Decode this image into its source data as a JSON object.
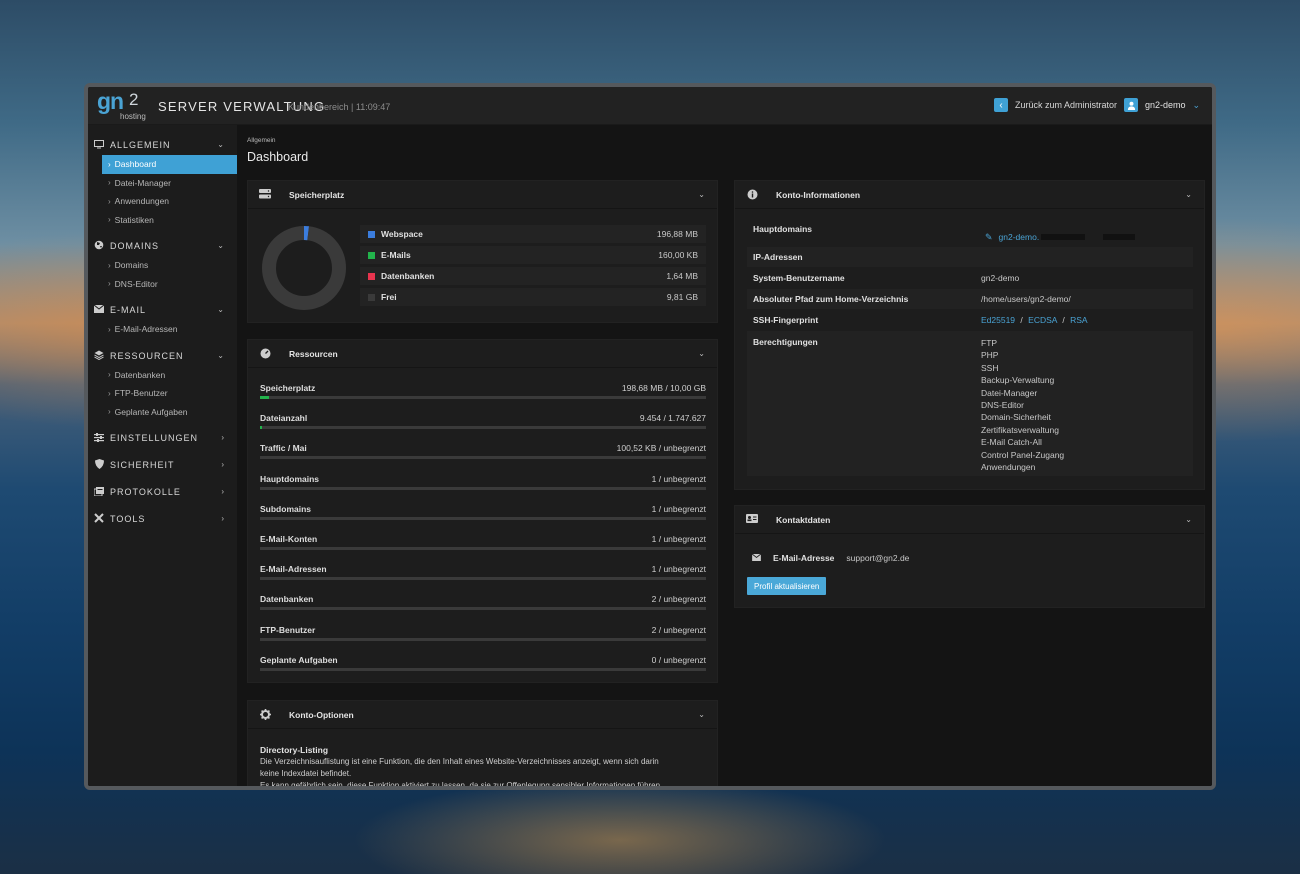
{
  "header": {
    "logo_main": "gn",
    "logo_sup": "2",
    "logo_sub": "hosting",
    "app_title": "SERVER VERWALTUNG",
    "app_subtitle": "Kundenbereich | 11:09:47",
    "admin_link": "Zurück zum Administrator",
    "user": "gn2-demo"
  },
  "sidebar": {
    "sections": [
      {
        "label": "ALLGEMEIN",
        "icon": "monitor-icon",
        "items": [
          "Dashboard",
          "Datei-Manager",
          "Anwendungen",
          "Statistiken"
        ]
      },
      {
        "label": "DOMAINS",
        "icon": "globe-icon",
        "items": [
          "Domains",
          "DNS-Editor"
        ]
      },
      {
        "label": "E-MAIL",
        "icon": "envelope-icon",
        "items": [
          "E-Mail-Adressen"
        ]
      },
      {
        "label": "RESSOURCEN",
        "icon": "layers-icon",
        "items": [
          "Datenbanken",
          "FTP-Benutzer",
          "Geplante Aufgaben"
        ]
      },
      {
        "label": "EINSTELLUNGEN",
        "icon": "sliders-icon",
        "items": []
      },
      {
        "label": "SICHERHEIT",
        "icon": "shield-icon",
        "items": []
      },
      {
        "label": "PROTOKOLLE",
        "icon": "logs-icon",
        "items": []
      },
      {
        "label": "TOOLS",
        "icon": "tools-icon",
        "items": []
      }
    ],
    "active_item": "Dashboard"
  },
  "main": {
    "breadcrumb": "Allgemein",
    "title": "Dashboard"
  },
  "storage": {
    "title": "Speicherplatz",
    "legend": [
      {
        "name": "Webspace",
        "value": "196,88 MB",
        "color": "#3b7ddd"
      },
      {
        "name": "E-Mails",
        "value": "160,00 KB",
        "color": "#22b34b"
      },
      {
        "name": "Datenbanken",
        "value": "1,64 MB",
        "color": "#e8344e"
      },
      {
        "name": "Frei",
        "value": "9,81 GB",
        "color": "#3a3a3a"
      }
    ],
    "donut_fractions": [
      0.0192,
      0.0001,
      0.0002,
      0.9805
    ]
  },
  "resources": {
    "title": "Ressourcen",
    "rows": [
      {
        "name": "Speicherplatz",
        "value": "198,68 MB / 10,00 GB",
        "fill": 0.02
      },
      {
        "name": "Dateianzahl",
        "value": "9.454 / 1.747.627",
        "fill": 0.005
      },
      {
        "name": "Traffic / Mai",
        "value": "100,52 KB / unbegrenzt",
        "fill": 0
      },
      {
        "name": "Hauptdomains",
        "value": "1 / unbegrenzt",
        "fill": 0
      },
      {
        "name": "Subdomains",
        "value": "1 / unbegrenzt",
        "fill": 0
      },
      {
        "name": "E-Mail-Konten",
        "value": "1 / unbegrenzt",
        "fill": 0
      },
      {
        "name": "E-Mail-Adressen",
        "value": "1 / unbegrenzt",
        "fill": 0
      },
      {
        "name": "Datenbanken",
        "value": "2 / unbegrenzt",
        "fill": 0
      },
      {
        "name": "FTP-Benutzer",
        "value": "2 / unbegrenzt",
        "fill": 0
      },
      {
        "name": "Geplante Aufgaben",
        "value": "0 / unbegrenzt",
        "fill": 0
      }
    ]
  },
  "account": {
    "title": "Konto-Informationen",
    "main_domains_label": "Hauptdomains",
    "main_domain_value": "gn2-demo.",
    "ip_label": "IP-Adressen",
    "username_label": "System-Benutzername",
    "username_value": "gn2-demo",
    "home_label": "Absoluter Pfad zum Home-Verzeichnis",
    "home_value": "/home/users/gn2-demo/",
    "ssh_label": "SSH-Fingerprint",
    "ssh_links": [
      "Ed25519",
      "ECDSA",
      "RSA"
    ],
    "ssh_sep": "/",
    "perm_label": "Berechtigungen",
    "permissions": [
      "FTP",
      "PHP",
      "SSH",
      "Backup-Verwaltung",
      "Datei-Manager",
      "DNS-Editor",
      "Domain-Sicherheit",
      "Zertifikatsverwaltung",
      "E-Mail Catch-All",
      "Control Panel-Zugang",
      "Anwendungen"
    ]
  },
  "contact": {
    "title": "Kontaktdaten",
    "email_label": "E-Mail-Adresse",
    "email_value": "support@gn2.de",
    "update_button": "Profil aktualisieren"
  },
  "options": {
    "title": "Konto-Optionen",
    "heading": "Directory-Listing",
    "line1": "Die Verzeichnisauflistung ist eine Funktion, die den Inhalt eines Website-Verzeichnisses anzeigt, wenn sich darin",
    "line2": "keine Indexdatei befindet.",
    "line3": "Es kann gefährlich sein, diese Funktion aktiviert zu lassen, da sie zur Offenlegung sensibler Informationen führen"
  }
}
